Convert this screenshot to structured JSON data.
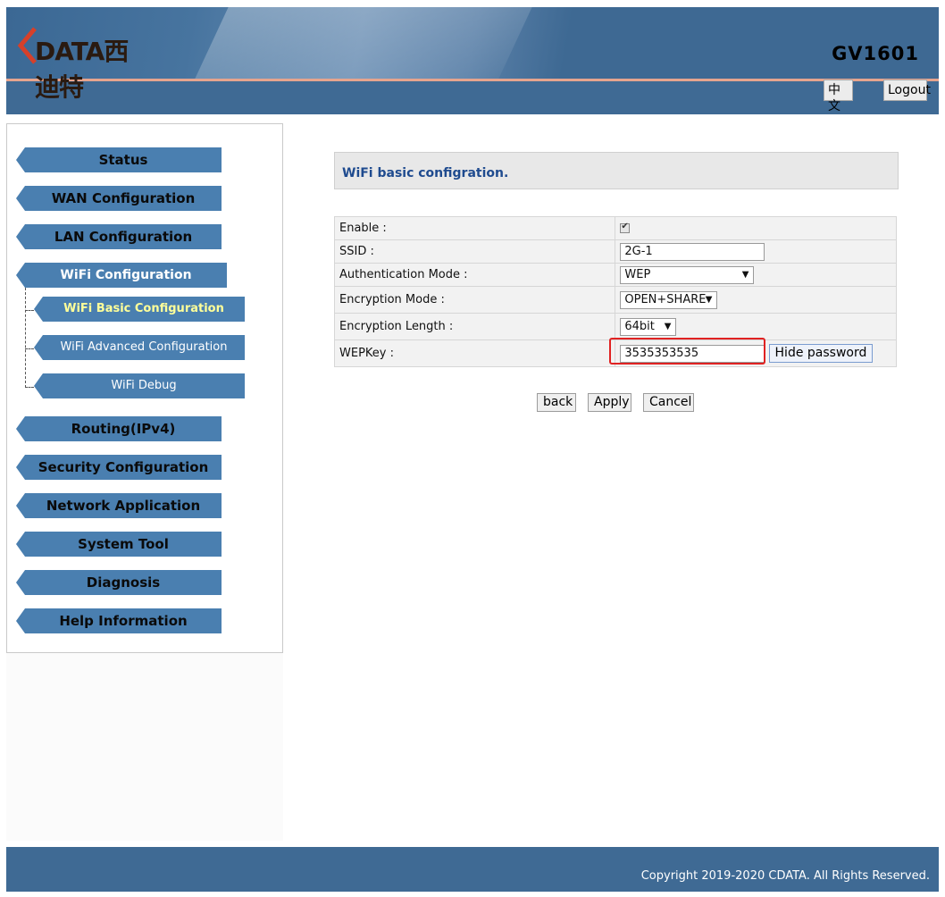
{
  "header": {
    "logo_text": "DATA西迪特",
    "model": "GV1601",
    "lang_button": "中文",
    "logout_button": "Logout",
    "colors": {
      "bar": "#3f6a94",
      "accent_line": "#e6a48e",
      "logo_red": "#d6402a"
    }
  },
  "sidebar": {
    "items": [
      {
        "label": "Status"
      },
      {
        "label": "WAN Configuration"
      },
      {
        "label": "LAN Configuration"
      },
      {
        "label": "WiFi Configuration",
        "active": true
      },
      {
        "label": "Routing(IPv4)"
      },
      {
        "label": "Security Configuration"
      },
      {
        "label": "Network Application"
      },
      {
        "label": "System Tool"
      },
      {
        "label": "Diagnosis"
      },
      {
        "label": "Help Information"
      }
    ],
    "submenu": [
      {
        "label": "WiFi Basic Configuration",
        "current": true
      },
      {
        "label": "WiFi Advanced Configuration"
      },
      {
        "label": "WiFi Debug"
      }
    ],
    "colors": {
      "item_bg": "#4a7fb0",
      "current_text": "#ffff99"
    }
  },
  "main": {
    "title": "WiFi basic configration.",
    "form": {
      "enable": {
        "label": "Enable :",
        "checked": true
      },
      "ssid": {
        "label": "SSID :",
        "value": "2G-1"
      },
      "auth_mode": {
        "label": "Authentication Mode :",
        "value": "WEP"
      },
      "enc_mode": {
        "label": "Encryption Mode :",
        "value": "OPEN+SHARE"
      },
      "enc_length": {
        "label": "Encryption Length :",
        "value": "64bit"
      },
      "wep_key": {
        "label": "WEPKey :",
        "value": "3535353535",
        "toggle_label": "Hide password"
      }
    },
    "buttons": {
      "back": "back",
      "apply": "Apply",
      "cancel": "Cancel"
    }
  },
  "footer": {
    "copyright": "Copyright 2019-2020 CDATA. All Rights Reserved."
  }
}
